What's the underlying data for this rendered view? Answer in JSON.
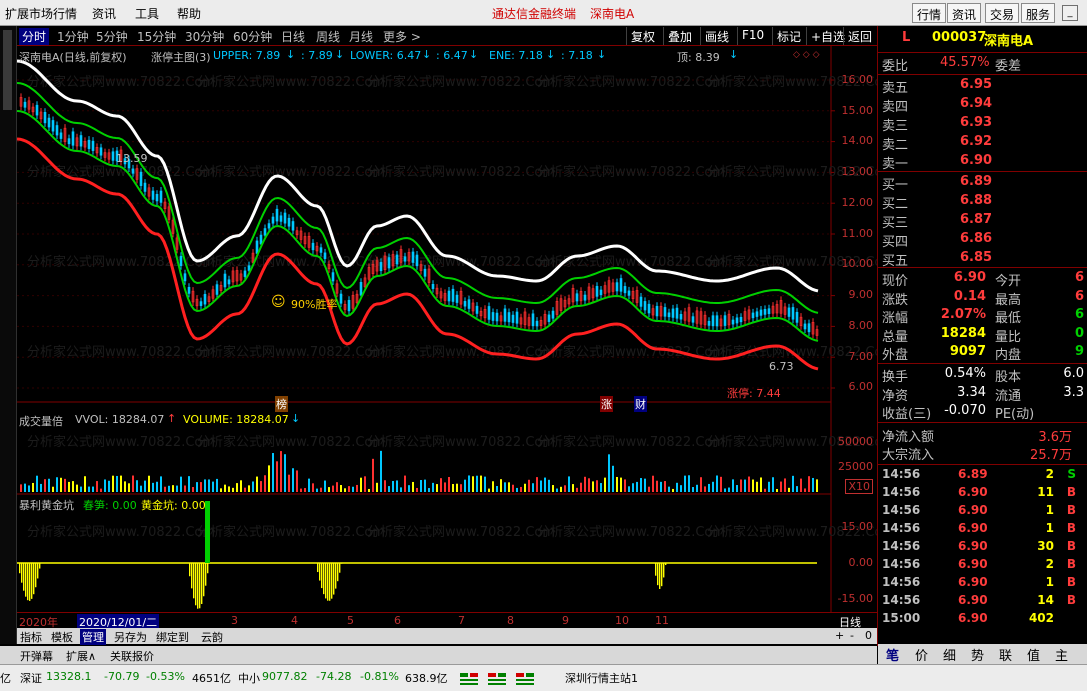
{
  "menubar": {
    "items": [
      "扩展市场行情",
      "资讯",
      "工具",
      "帮助"
    ],
    "title": "通达信金融终端",
    "stock_title": "深南电A",
    "buttons": [
      "行情",
      "资讯",
      "交易",
      "服务"
    ]
  },
  "periodbar": {
    "periods": [
      "分时",
      "1分钟",
      "5分钟",
      "15分钟",
      "30分钟",
      "60分钟",
      "日线",
      "周线",
      "月线",
      "更多 >"
    ],
    "active": "分时",
    "tools": [
      "复权",
      "叠加",
      "画线",
      "F10",
      "标记",
      "+自选",
      "返回"
    ]
  },
  "main_chart": {
    "title": "深南电A(日线,前复权)",
    "indicator": "涨停主图(3)",
    "upper_label": "UPPER: 7.89",
    "upper_val2": ": 7.89",
    "lower_label": "LOWER: 6.47",
    "lower_val2": ": 6.47",
    "ene_label": "ENE: 7.18",
    "ene_val2": ": 7.18",
    "top_label": "顶: 8.39",
    "high_mark": "13.59",
    "low_mark": "6.73",
    "smile_text": "90%胜率",
    "limit_text": "涨停: 7.44",
    "badge_bang": "榜",
    "badge_zhang": "涨",
    "badge_cai": "财",
    "y_ticks": [
      "16.00",
      "15.00",
      "14.00",
      "13.00",
      "12.00",
      "11.00",
      "10.00",
      "9.00",
      "8.00",
      "7.00",
      "6.00"
    ],
    "watermark": "分析家公式网www.70822.Com"
  },
  "volume_chart": {
    "title": "成交量倍",
    "vol_label": "VVOL: 18284.07",
    "volume_label": "VOLUME: 18284.07",
    "y_ticks": [
      "50000",
      "25000"
    ],
    "scale": "X10"
  },
  "profit_chart": {
    "title": "暴利黄金坑",
    "label1": "春笋: 0.00",
    "label2": "黄金坑: 0.00",
    "y_ticks": [
      "15.00",
      "0.00",
      "-15.00"
    ]
  },
  "datebar": {
    "year": "2020年",
    "current": "2020/12/01/二",
    "months": [
      "3",
      "4",
      "5",
      "6",
      "7",
      "8",
      "9",
      "10",
      "11"
    ],
    "right": "日线"
  },
  "bottom_tabs": [
    "指标",
    "模板",
    "管理",
    "另存为",
    "绑定到",
    "云韵"
  ],
  "bottom_tabs_active": "管理",
  "status_tabs": [
    "开弹幕",
    "扩展∧",
    "关联报价"
  ],
  "ticker": {
    "sh_suffix": "亿",
    "sz_label": "深证",
    "sz_price": "13328.1",
    "sz_change": "-70.79",
    "sz_pct": "-0.53%",
    "sz_amount": "4651亿",
    "zx_label": "中小",
    "zx_price": "9077.82",
    "zx_change": "-74.28",
    "zx_pct": "-0.81%",
    "zx_amount": "638.9亿",
    "server": "深圳行情主站1"
  },
  "quote": {
    "flag": "L",
    "code": "000037",
    "name": "深南电A",
    "weibi_label": "委比",
    "weibi_val": "45.57%",
    "weicha_label": "委差",
    "asks": [
      {
        "label": "卖五",
        "price": "6.95"
      },
      {
        "label": "卖四",
        "price": "6.94"
      },
      {
        "label": "卖三",
        "price": "6.93"
      },
      {
        "label": "卖二",
        "price": "6.92"
      },
      {
        "label": "卖一",
        "price": "6.90"
      }
    ],
    "bids": [
      {
        "label": "买一",
        "price": "6.89"
      },
      {
        "label": "买二",
        "price": "6.88"
      },
      {
        "label": "买三",
        "price": "6.87"
      },
      {
        "label": "买四",
        "price": "6.86"
      },
      {
        "label": "买五",
        "price": "6.85"
      }
    ],
    "stats": [
      {
        "l1": "现价",
        "v1": "6.90",
        "c1": "#ff3c3c",
        "l2": "今开",
        "v2": "6",
        "c2": "#ff3c3c"
      },
      {
        "l1": "涨跌",
        "v1": "0.14",
        "c1": "#ff3c3c",
        "l2": "最高",
        "v2": "6",
        "c2": "#ff3c3c"
      },
      {
        "l1": "涨幅",
        "v1": "2.07%",
        "c1": "#ff3c3c",
        "l2": "最低",
        "v2": "6",
        "c2": "#00d000"
      },
      {
        "l1": "总量",
        "v1": "18284",
        "c1": "#ffff00",
        "l2": "量比",
        "v2": "0",
        "c2": "#00d000"
      },
      {
        "l1": "外盘",
        "v1": "9097",
        "c1": "#ffff00",
        "l2": "内盘",
        "v2": "9",
        "c2": "#00d000"
      }
    ],
    "stats2": [
      {
        "l1": "换手",
        "v1": "0.54%",
        "l2": "股本",
        "v2": "6.0"
      },
      {
        "l1": "净资",
        "v1": "3.34",
        "l2": "流通",
        "v2": "3.3"
      },
      {
        "l1": "收益(三)",
        "v1": "-0.070",
        "l2": "PE(动)",
        "v2": ""
      }
    ],
    "flow": [
      {
        "label": "净流入额",
        "val": "3.6万"
      },
      {
        "label": "大宗流入",
        "val": "25.7万"
      }
    ],
    "trades": [
      {
        "time": "14:56",
        "price": "6.89",
        "vol": "2",
        "side": "S"
      },
      {
        "time": "14:56",
        "price": "6.90",
        "vol": "11",
        "side": "B"
      },
      {
        "time": "14:56",
        "price": "6.90",
        "vol": "1",
        "side": "B"
      },
      {
        "time": "14:56",
        "price": "6.90",
        "vol": "1",
        "side": "B"
      },
      {
        "time": "14:56",
        "price": "6.90",
        "vol": "30",
        "side": "B"
      },
      {
        "time": "14:56",
        "price": "6.90",
        "vol": "2",
        "side": "B"
      },
      {
        "time": "14:56",
        "price": "6.90",
        "vol": "1",
        "side": "B"
      },
      {
        "time": "14:56",
        "price": "6.90",
        "vol": "14",
        "side": "B"
      },
      {
        "time": "15:00",
        "price": "6.90",
        "vol": "402",
        "side": ""
      }
    ],
    "tabs": [
      "笔",
      "价",
      "细",
      "势",
      "联",
      "值",
      "主"
    ]
  },
  "colors": {
    "up": "#ff3c3c",
    "down": "#00d000",
    "yellow": "#ffff00",
    "cyan": "#00c8ff",
    "frame": "#800000"
  }
}
